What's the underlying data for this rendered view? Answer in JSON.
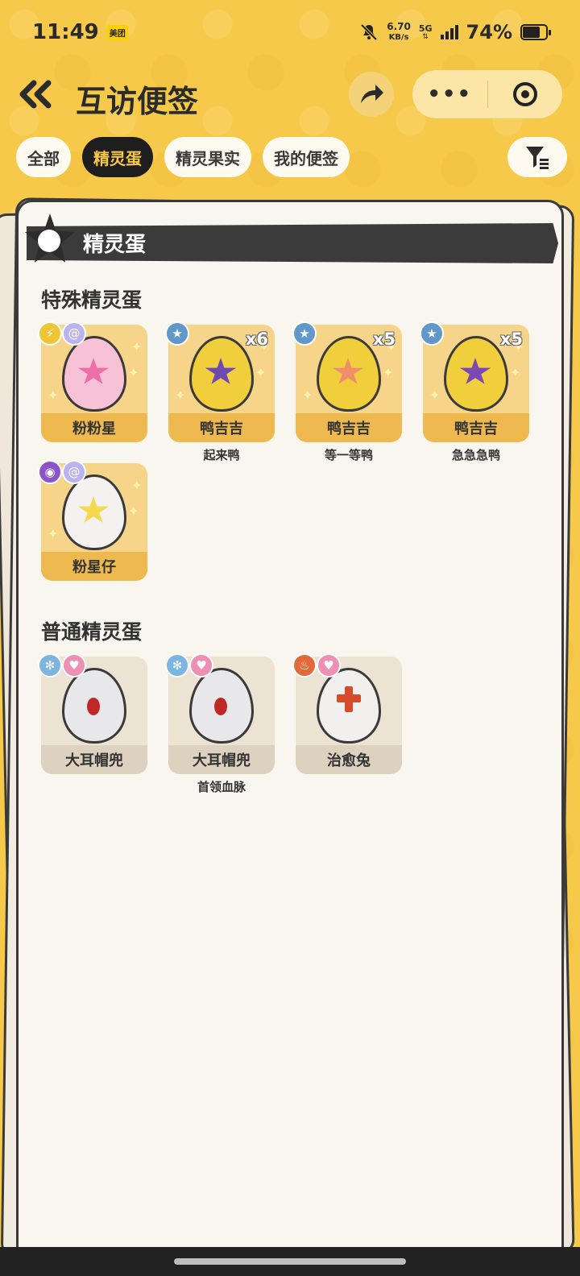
{
  "status_bar": {
    "time": "11:49",
    "app_badge": "美团",
    "net_speed_value": "6.70",
    "net_speed_unit": "KB/s",
    "network": "5G",
    "battery": "74%"
  },
  "header": {
    "title": "互访便签"
  },
  "tabs": [
    {
      "label": "全部",
      "active": false
    },
    {
      "label": "精灵蛋",
      "active": true
    },
    {
      "label": "精灵果实",
      "active": false
    },
    {
      "label": "我的便签",
      "active": false
    }
  ],
  "banner": {
    "title": "精灵蛋"
  },
  "sections": {
    "special": {
      "title": "特殊精灵蛋",
      "items": [
        {
          "name": "粉粉星",
          "sub": "",
          "count": "",
          "badges": [
            "electric-icon",
            "swirl-icon"
          ],
          "egg_color": "#f7c1d6",
          "mark_color": "#ee6fa8"
        },
        {
          "name": "鸭吉吉",
          "sub": "起来鸭",
          "count": "x6",
          "badges": [
            "star-icon"
          ],
          "egg_color": "#f1cf3c",
          "mark_color": "#6d4ab0"
        },
        {
          "name": "鸭吉吉",
          "sub": "等一等鸭",
          "count": "x5",
          "badges": [
            "star-icon"
          ],
          "egg_color": "#f1cf3c",
          "mark_color": "#f08d6a"
        },
        {
          "name": "鸭吉吉",
          "sub": "急急急鸭",
          "count": "x5",
          "badges": [
            "star-icon"
          ],
          "egg_color": "#f1cf3c",
          "mark_color": "#7a49b6"
        },
        {
          "name": "粉星仔",
          "sub": "",
          "count": "",
          "badges": [
            "ghost-icon",
            "swirl-icon"
          ],
          "egg_color": "#f4f1f0",
          "mark_color": "#f4d84d"
        }
      ]
    },
    "normal": {
      "title": "普通精灵蛋",
      "items": [
        {
          "name": "大耳帽兜",
          "sub": "",
          "badges": [
            "ice-icon",
            "heart-icon"
          ],
          "egg_color": "#e8e8ea",
          "mark_color": "#c02828"
        },
        {
          "name": "大耳帽兜",
          "sub": "首领血脉",
          "badges": [
            "ice-icon",
            "heart-icon"
          ],
          "egg_color": "#e8e8ea",
          "mark_color": "#c02828"
        },
        {
          "name": "治愈兔",
          "sub": "",
          "badges": [
            "fire-icon",
            "heart-icon"
          ],
          "egg_color": "#f2f0ee",
          "mark_color": "#d84a2c"
        }
      ]
    }
  },
  "colors": {
    "background": "#f7c94a",
    "tab_active_bg": "#1e1e1e",
    "tab_active_text": "#f8c84a",
    "special_card": "#f6d58a",
    "normal_card": "#ece3d2"
  }
}
